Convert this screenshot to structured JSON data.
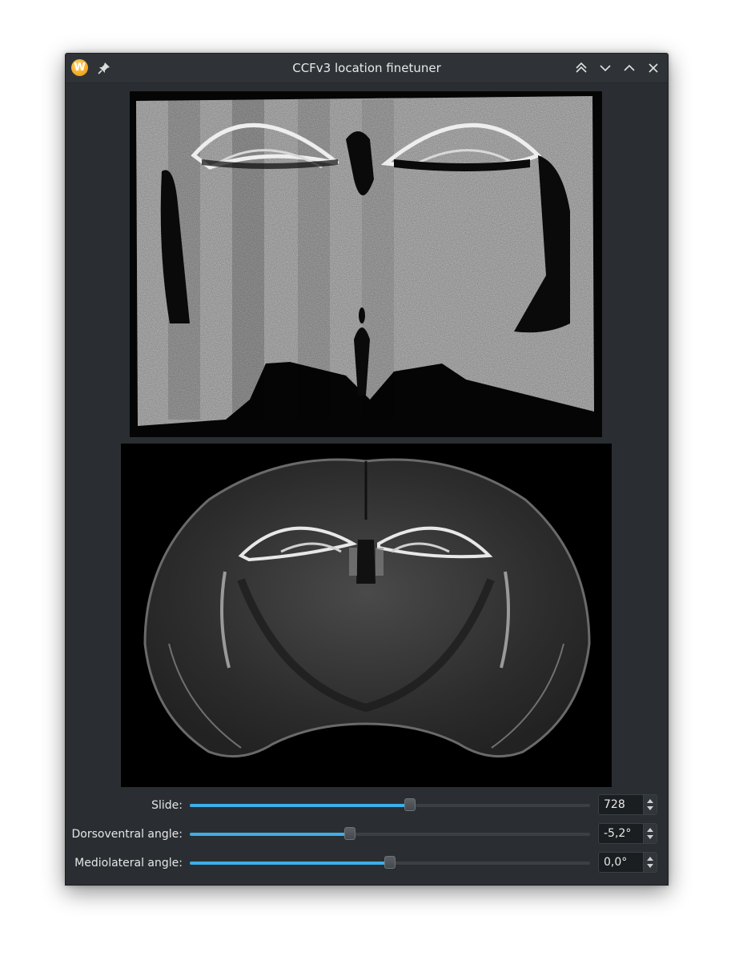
{
  "window": {
    "title": "CCFv3 location finetuner",
    "app_icon": "W"
  },
  "icons": {
    "app": "app-w-icon",
    "pin": "pin-icon",
    "keep_above": "double-chevron-up-icon",
    "minimize": "chevron-down-icon",
    "maximize": "chevron-up-icon",
    "close": "close-icon"
  },
  "controls": [
    {
      "label": "Slide:",
      "value": "728",
      "level": 0.55
    },
    {
      "label": "Dorsoventral angle:",
      "value": "-5,2°",
      "level": 0.4
    },
    {
      "label": "Mediolateral angle:",
      "value": "0,0°",
      "level": 0.5
    }
  ],
  "colors": {
    "accent": "#3daee9",
    "window_bg": "#2a2e32",
    "titlebar_bg": "#2f3337",
    "text": "#e6e6e6"
  }
}
